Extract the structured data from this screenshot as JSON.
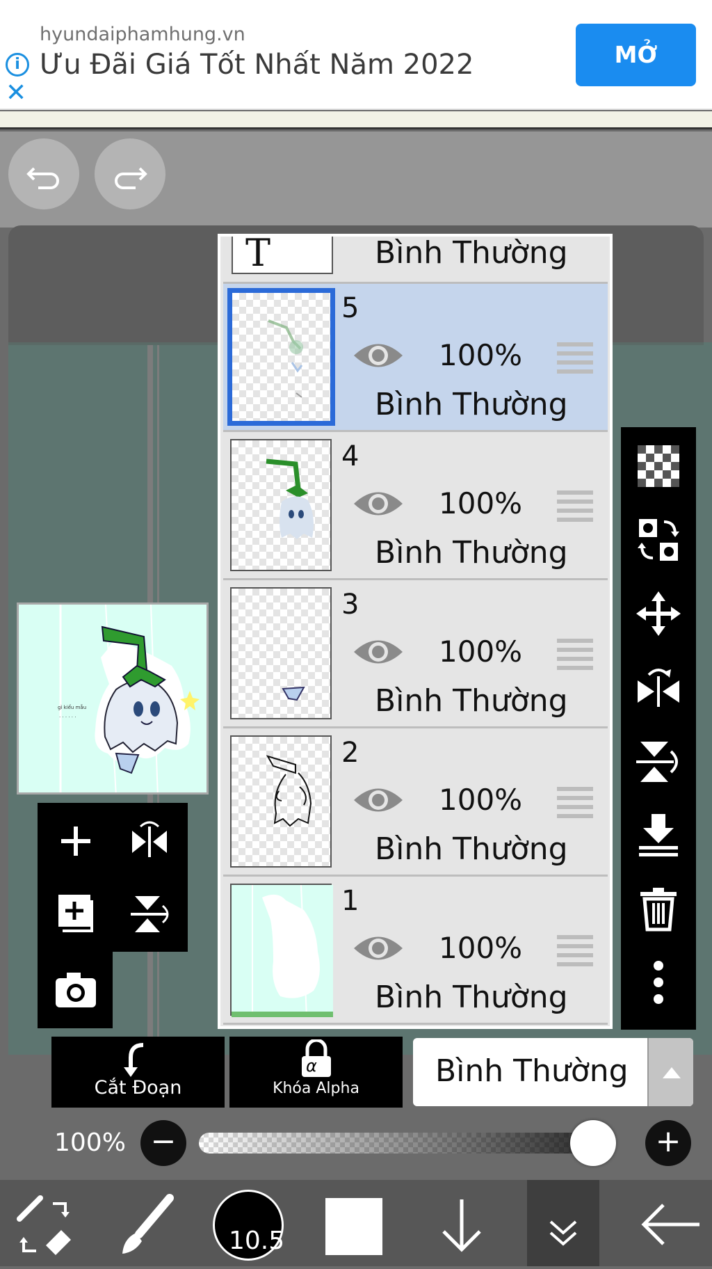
{
  "ad": {
    "domain": "hyundaiphamhung.vn",
    "headline": "Ưu Đãi Giá Tốt Nhất Năm 2022",
    "open_label": "MỞ",
    "info_icon": "ⓘ",
    "close_icon": "✕"
  },
  "layers_panel": {
    "top_partial": {
      "thumb_icon": "T",
      "mode": "Bình Thường"
    },
    "layers": [
      {
        "number": "5",
        "opacity": "100%",
        "mode": "Bình Thường",
        "selected": true
      },
      {
        "number": "4",
        "opacity": "100%",
        "mode": "Bình Thường",
        "selected": false
      },
      {
        "number": "3",
        "opacity": "100%",
        "mode": "Bình Thường",
        "selected": false
      },
      {
        "number": "2",
        "opacity": "100%",
        "mode": "Bình Thường",
        "selected": false
      },
      {
        "number": "1",
        "opacity": "100%",
        "mode": "Bình Thường",
        "selected": false
      }
    ]
  },
  "right_tools": [
    "transparent-icon",
    "swap-icon",
    "move-icon",
    "flip-horizontal-icon",
    "flip-vertical-icon",
    "merge-down-icon",
    "trash-icon",
    "more-icon"
  ],
  "left_tools": [
    "add-layer-icon",
    "flip-h-icon",
    "add-copy-icon",
    "flip-v-icon",
    "camera-icon"
  ],
  "bottom_buttons": {
    "clip_label": "Cắt Đoạn",
    "alpha_lock_label": "Khóa Alpha",
    "alpha_symbol": "α"
  },
  "blend_mode": {
    "value": "Bình Thường"
  },
  "opacity": {
    "value": "100%",
    "level": 1.0
  },
  "toolbar": {
    "brush_size": "10.5"
  },
  "colors": {
    "accent": "#1a8cf0",
    "selected_layer": "#c5d5ec",
    "selected_border": "#2b6ad8"
  }
}
